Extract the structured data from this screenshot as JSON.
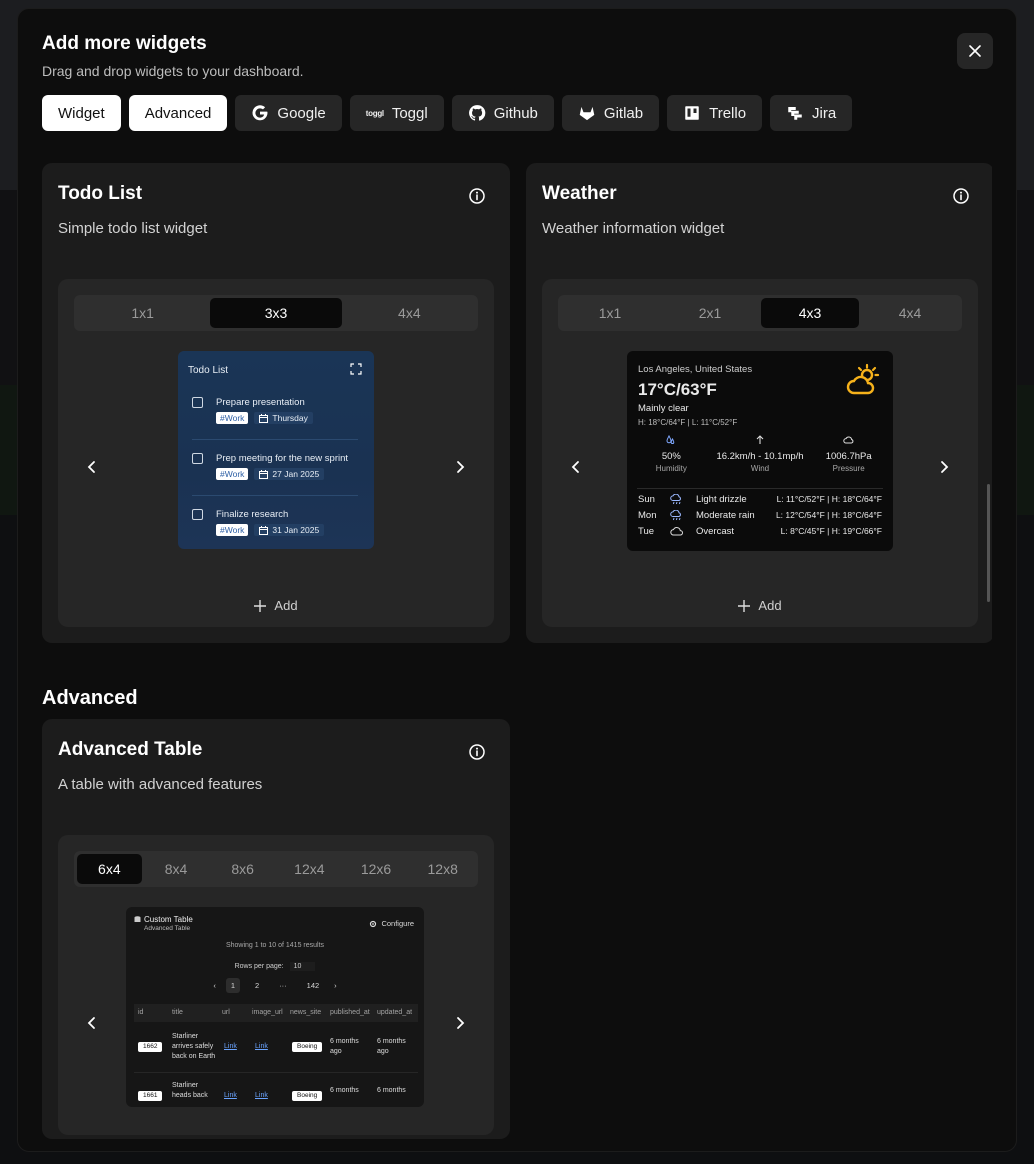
{
  "modal": {
    "title": "Add more widgets",
    "subtitle": "Drag and drop widgets to your dashboard.",
    "close_icon": "close-icon"
  },
  "tabs": [
    {
      "label": "Widget",
      "active": true,
      "icon": ""
    },
    {
      "label": "Advanced",
      "active": true,
      "icon": ""
    },
    {
      "label": "Google",
      "active": false,
      "icon": "google-icon"
    },
    {
      "label": "Toggl",
      "active": false,
      "icon": "toggl-icon",
      "icon_text": "toggl"
    },
    {
      "label": "Github",
      "active": false,
      "icon": "github-icon"
    },
    {
      "label": "Gitlab",
      "active": false,
      "icon": "gitlab-icon"
    },
    {
      "label": "Trello",
      "active": false,
      "icon": "trello-icon"
    },
    {
      "label": "Jira",
      "active": false,
      "icon": "jira-icon"
    }
  ],
  "widgets": {
    "todo": {
      "title": "Todo List",
      "description": "Simple todo list widget",
      "sizes": [
        "1x1",
        "3x3",
        "4x4"
      ],
      "active_size": "3x3",
      "add_label": "Add",
      "preview": {
        "title": "Todo List",
        "items": [
          {
            "text": "Prepare presentation",
            "tag": "#Work",
            "date": "Thursday"
          },
          {
            "text": "Prep meeting for the new sprint",
            "tag": "#Work",
            "date": "27 Jan 2025"
          },
          {
            "text": "Finalize research",
            "tag": "#Work",
            "date": "31 Jan 2025"
          }
        ]
      }
    },
    "weather": {
      "title": "Weather",
      "description": "Weather information widget",
      "sizes": [
        "1x1",
        "2x1",
        "4x3",
        "4x4"
      ],
      "active_size": "4x3",
      "add_label": "Add",
      "preview": {
        "location": "Los Angeles, United States",
        "temp": "17°C/63°F",
        "condition": "Mainly clear",
        "high_low": "H: 18°C/64°F   |   L: 11°C/52°F",
        "stats": [
          {
            "value": "50%",
            "label": "Humidity",
            "icon": "humidity-icon"
          },
          {
            "value": "16.2km/h - 10.1mp/h",
            "label": "Wind",
            "icon": "arrow-up-icon"
          },
          {
            "value": "1006.7hPa",
            "label": "Pressure",
            "icon": "cloud-icon"
          }
        ],
        "forecast": [
          {
            "day": "Sun",
            "desc": "Light drizzle",
            "range": "L: 11°C/52°F | H: 18°C/64°F",
            "icon": "rain-cloud-icon"
          },
          {
            "day": "Mon",
            "desc": "Moderate rain",
            "range": "L: 12°C/54°F | H: 18°C/64°F",
            "icon": "rain-cloud-icon"
          },
          {
            "day": "Tue",
            "desc": "Overcast",
            "range": "L: 8°C/45°F | H: 19°C/66°F",
            "icon": "cloud-icon"
          }
        ]
      }
    }
  },
  "advanced_section": {
    "title": "Advanced",
    "table_widget": {
      "title": "Advanced Table",
      "description": "A table with advanced features",
      "sizes": [
        "6x4",
        "8x4",
        "8x6",
        "12x4",
        "12x6",
        "12x8"
      ],
      "active_size": "6x4",
      "preview": {
        "title": "Custom Table",
        "subtitle": "Advanced Table",
        "configure": "Configure",
        "showing": "Showing 1 to 10 of 1415 results",
        "rows_per_page_label": "Rows per page:",
        "rows_per_page": "10",
        "pages": [
          "1",
          "2",
          "···",
          "142"
        ],
        "columns": [
          "id",
          "title",
          "url",
          "image_url",
          "news_site",
          "published_at",
          "updated_at"
        ],
        "rows": [
          {
            "id": "1662",
            "title": "Starliner arrives safely back on Earth",
            "url": "Link",
            "image_url": "Link",
            "news_site": "Boeing",
            "published_at": "6 months ago",
            "updated_at": "6 months ago"
          },
          {
            "id": "1661",
            "title": "Starliner heads back",
            "url": "Link",
            "image_url": "Link",
            "news_site": "Boeing",
            "published_at": "6 months",
            "updated_at": "6 months"
          }
        ]
      }
    }
  }
}
